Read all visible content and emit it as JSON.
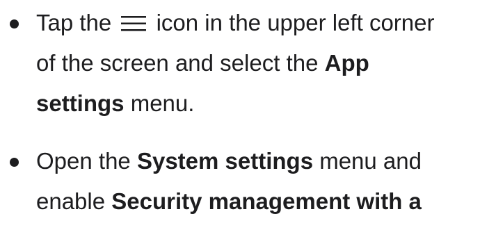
{
  "steps": [
    {
      "line1_pre": "Tap the",
      "icon": "hamburger-menu-icon",
      "line1_post": "icon in the upper left corner",
      "line2_pre": "of the screen and select the",
      "line2_bold": "App",
      "line3_bold": "settings",
      "line3_post": "menu."
    },
    {
      "line1_pre": "Open the",
      "line1_bold": "System settings",
      "line1_post": "menu and",
      "line2_pre": "enable",
      "line2_bold": "Security management with a"
    }
  ]
}
